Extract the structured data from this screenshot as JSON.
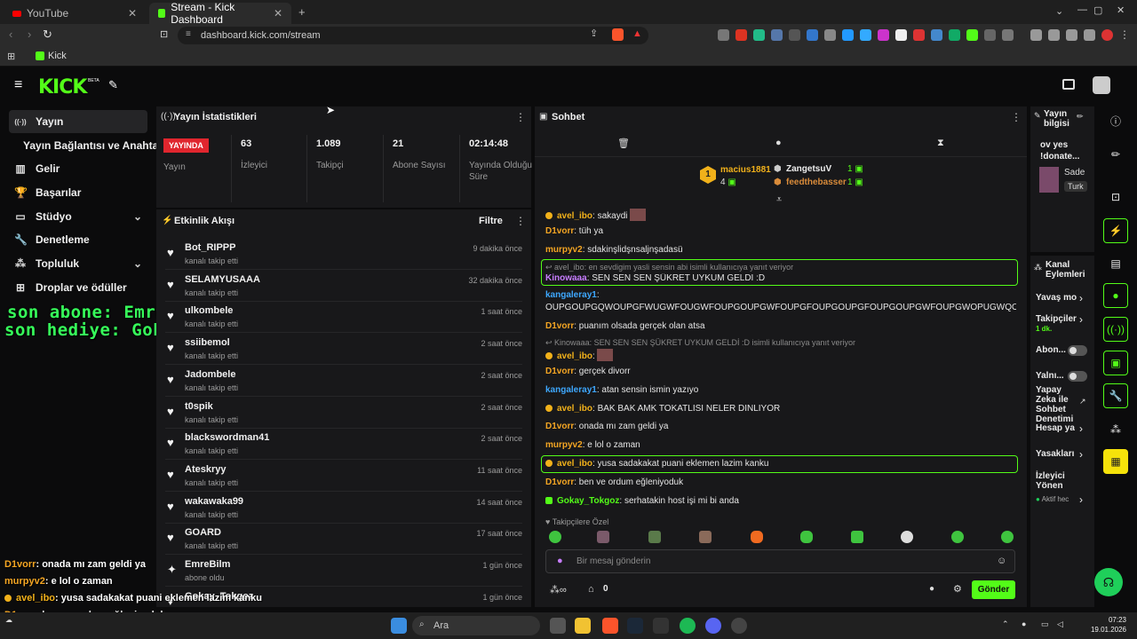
{
  "browser": {
    "tabs": [
      {
        "label": "YouTube",
        "active": false
      },
      {
        "label": "Stream - Kick Dashboard",
        "active": true
      }
    ],
    "url": "dashboard.kick.com/stream",
    "bookmark": "Kick"
  },
  "header": {
    "logo": "KICK",
    "beta": "BETA"
  },
  "nav": {
    "items": [
      {
        "label": "Yayın",
        "icon": "broadcast-icon",
        "active": true
      },
      {
        "label": "Yayın Bağlantısı ve Anahtarı",
        "icon": "",
        "active": false
      },
      {
        "label": "Gelir",
        "icon": "revenue-icon",
        "active": false
      },
      {
        "label": "Başarılar",
        "icon": "trophy-icon",
        "active": false
      },
      {
        "label": "Stüdyo",
        "icon": "studio-icon",
        "active": false,
        "chevron": true
      },
      {
        "label": "Denetleme",
        "icon": "wrench-icon",
        "active": false
      },
      {
        "label": "Topluluk",
        "icon": "community-icon",
        "active": false,
        "chevron": true
      },
      {
        "label": "Droplar ve ödüller",
        "icon": "gift-icon",
        "active": false
      }
    ]
  },
  "stats": {
    "title": "Yayın İstatistikleri",
    "live_badge": "YAYINDA",
    "live_label": "Yayın",
    "cells": [
      {
        "value": "63",
        "label": "İzleyici"
      },
      {
        "value": "1.089",
        "label": "Takipçi"
      },
      {
        "value": "21",
        "label": "Abone Sayısı"
      },
      {
        "value": "02:14:48",
        "label": "Yayında Olduğu Süre"
      }
    ]
  },
  "activity": {
    "title": "Etkinlik Akışı",
    "filter": "Filtre",
    "items": [
      {
        "name": "Bot_RIPPP",
        "action": "kanalı takip etti",
        "time": "9 dakika önce"
      },
      {
        "name": "SELAMYUSAAA",
        "action": "kanalı takip etti",
        "time": "32 dakika önce"
      },
      {
        "name": "ulkombele",
        "action": "kanalı takip etti",
        "time": "1 saat önce"
      },
      {
        "name": "ssiibemol",
        "action": "kanalı takip etti",
        "time": "2 saat önce"
      },
      {
        "name": "Jadombele",
        "action": "kanalı takip etti",
        "time": "2 saat önce"
      },
      {
        "name": "t0spik",
        "action": "kanalı takip etti",
        "time": "2 saat önce"
      },
      {
        "name": "blackswordman41",
        "action": "kanalı takip etti",
        "time": "2 saat önce"
      },
      {
        "name": "Ateskryy",
        "action": "kanalı takip etti",
        "time": "11 saat önce"
      },
      {
        "name": "wakawaka99",
        "action": "kanalı takip etti",
        "time": "14 saat önce"
      },
      {
        "name": "GOARD",
        "action": "kanalı takip etti",
        "time": "17 saat önce"
      },
      {
        "name": "EmreBilm",
        "action": "abone oldu",
        "time": "1 gün önce"
      },
      {
        "name": "Gokay_Tokgoz",
        "action": "",
        "time": "1 gün önce"
      }
    ]
  },
  "chat": {
    "title": "Sohbet",
    "leaderboard": {
      "first": {
        "name": "macius1881",
        "count": "4"
      },
      "second": {
        "name": "ZangetsuV",
        "count": "1"
      },
      "third": {
        "name": "feedthebasser",
        "count": "1"
      }
    },
    "messages": [
      {
        "user": "avel_ibo",
        "color": "#f1b11a",
        "text": ": sakaydi",
        "badge": true
      },
      {
        "user": "D1vorr",
        "color": "#f5a623",
        "text": ": tüh ya"
      },
      {
        "user": "murpyv2",
        "color": "#f5a623",
        "text": ": sdakinşlidşnsaljnşadasü"
      },
      {
        "user": "Kinowaaa",
        "color": "#c77dff",
        "text": ": SEN SEN SEN ŞÜKRET UYKUM GELDİ :D",
        "reply": "avel_ibo: en sevdigim yasli sensin abi isimli kullanıcıya yanıt veriyor"
      },
      {
        "user": "kangaleray1",
        "color": "#3ea8ff",
        "text": ":"
      },
      {
        "user": "",
        "color": "#fff",
        "text": "OUPGOUPGQWOUPGFWUGWFOUGWFOUPGOUPGWFOUPGFOUPGOUPGFOUPGOUPGWFOUPGWOPUGWQOUPG"
      },
      {
        "user": "D1vorr",
        "color": "#f5a623",
        "text": ": puanım olsada gerçek olan atsa"
      },
      {
        "user": "avel_ibo",
        "color": "#f1b11a",
        "text": ":",
        "badge": true,
        "reply": "Kinowaaa: SEN SEN SEN ŞÜKRET UYKUM GELDİ :D isimli kullanıcıya yanıt veriyor"
      },
      {
        "user": "D1vorr",
        "color": "#f5a623",
        "text": ": gerçek divorr"
      },
      {
        "user": "kangaleray1",
        "color": "#3ea8ff",
        "text": ": atan sensin ismin yazıyo"
      },
      {
        "user": "avel_ibo",
        "color": "#f1b11a",
        "text": ": BAK BAK AMK TOKATLİSİ NELER DİNLİYOR",
        "badge": true
      },
      {
        "user": "D1vorr",
        "color": "#f5a623",
        "text": ": onada mı zam geldi ya"
      },
      {
        "user": "murpyv2",
        "color": "#f5a623",
        "text": ": e lol o zaman"
      },
      {
        "user": "avel_ibo",
        "color": "#f1b11a",
        "text": ": yusa sadakakat puani eklemen lazim kanku",
        "badge": true
      },
      {
        "user": "D1vorr",
        "color": "#f5a623",
        "text": ": ben ve ordum eğleniyoduk"
      },
      {
        "user": "Gokay_Tokgoz",
        "color": "#53fc18",
        "text": ": serhatakin host işi mi bi anda",
        "badge": true
      }
    ],
    "emote_label": "Takipçilere Özel",
    "input_placeholder": "Bir mesaj gönderin",
    "points": "0",
    "send": "Gönder"
  },
  "stream_info": {
    "title": "Yayın bilgisi",
    "line1": "ov yes",
    "line2": "!donate...",
    "cat1": "Sade",
    "cat2": "Turk"
  },
  "channel_actions": {
    "title": "Kanal Eylemleri",
    "items": [
      {
        "label": "Yavaş mo",
        "type": "chevron"
      },
      {
        "label": "Takipçiler",
        "sub": "1 dk.",
        "type": "chevron"
      },
      {
        "label": "Abon...",
        "type": "toggle"
      },
      {
        "label": "Yalnı...",
        "type": "toggle"
      },
      {
        "label": "Yapay Zeka ile Sohbet Denetimi",
        "type": "external"
      },
      {
        "label": "Hesap ya",
        "type": "chevron"
      },
      {
        "label": "Yasakları",
        "type": "chevron"
      },
      {
        "label": "İzleyici Yönen",
        "type": "none"
      },
      {
        "label": "Aktif hec",
        "type": "chevron"
      }
    ]
  },
  "overlay": {
    "line1": "son abone: EmreBilm",
    "line2": "son hediye: Gokay_Tokgoz",
    "chat": [
      {
        "user": "D1vorr",
        "color": "#f5a623",
        "text": ": onada mı zam geldi ya"
      },
      {
        "user": "murpyv2",
        "color": "#f5a623",
        "text": ": e lol o zaman"
      },
      {
        "user": "avel_ibo",
        "color": "#f1b11a",
        "text": ": yusa sadakakat puani eklemen lazim kanku"
      },
      {
        "user": "D1vorr",
        "color": "#f5a623",
        "text": ": ben ve ordum eğleniyoduk"
      },
      {
        "user": "Gokay_Tokgoz",
        "color": "#53fc18",
        "text": ": serhatakin host işi mi bi anda"
      }
    ]
  },
  "taskbar": {
    "search": "Ara",
    "time": "07:23",
    "date": "19.01.2026"
  }
}
